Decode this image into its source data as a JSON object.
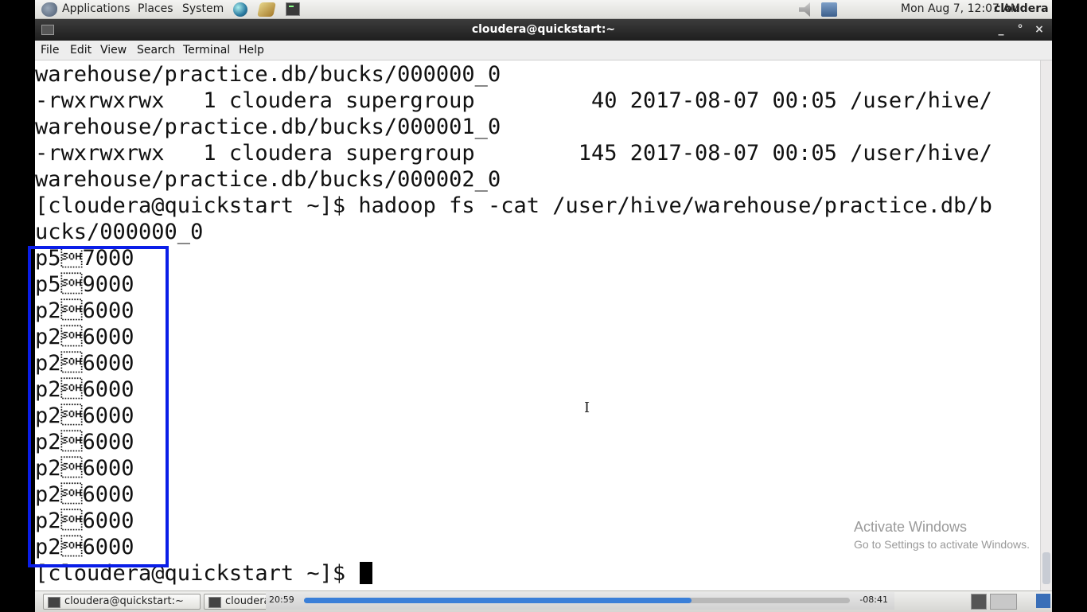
{
  "top_panel": {
    "menus": [
      "Applications",
      "Places",
      "System"
    ],
    "clock": "Mon Aug  7, 12:07 AM",
    "user": "cloudera"
  },
  "window": {
    "title": "cloudera@quickstart:~",
    "controls": [
      "_",
      "°",
      "×"
    ],
    "menu": [
      "File",
      "Edit",
      "View",
      "Search",
      "Terminal",
      "Help"
    ]
  },
  "terminal": {
    "lines": [
      "warehouse/practice.db/bucks/000000_0",
      "-rwxrwxrwx   1 cloudera supergroup         40 2017-08-07 00:05 /user/hive/",
      "warehouse/practice.db/bucks/000001_0",
      "-rwxrwxrwx   1 cloudera supergroup        145 2017-08-07 00:05 /user/hive/",
      "warehouse/practice.db/bucks/000002_0",
      "[cloudera@quickstart ~]$ hadoop fs -cat /user/hive/warehouse/practice.db/b",
      "ucks/000000_0",
      "p5\u00017000",
      "p5\u00019000",
      "p2\u00016000",
      "p2\u00016000",
      "p2\u00016000",
      "p2\u00016000",
      "p2\u00016000",
      "p2\u00016000",
      "p2\u00016000",
      "p2\u00016000",
      "p2\u00016000",
      "p2\u00016000"
    ],
    "prompt": "[cloudera@quickstart ~]$ "
  },
  "watermark": {
    "title": "Activate Windows",
    "subtitle": "Go to Settings to activate Windows."
  },
  "taskbar": {
    "tasks": [
      "cloudera@quickstart:~",
      "cloudera@quickstart:~"
    ],
    "player": {
      "elapsed": "20:59",
      "remaining": "-08:41",
      "progress_fraction": 0.71
    }
  },
  "colors": {
    "highlight": "#0a1ee8",
    "progress": "#3a7fd8"
  }
}
